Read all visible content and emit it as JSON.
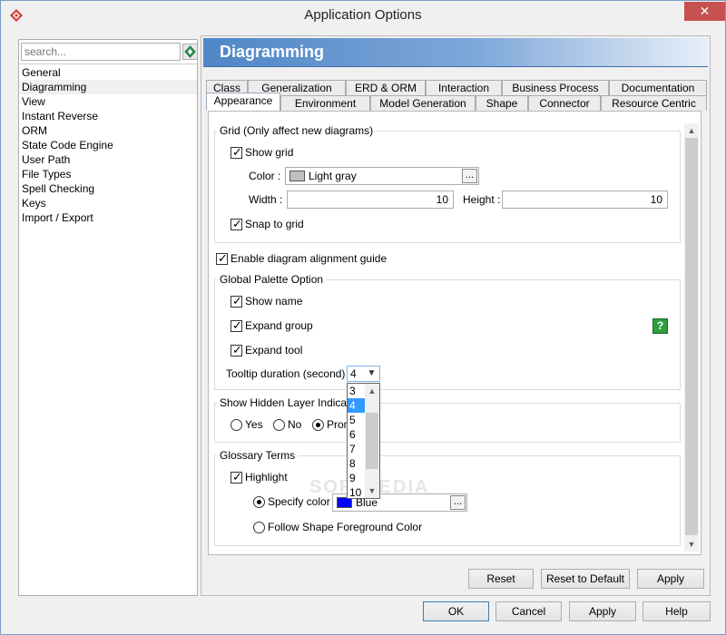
{
  "window": {
    "title": "Application Options",
    "close_glyph": "✕"
  },
  "search": {
    "placeholder": "search...",
    "icon": "diamond-search-icon"
  },
  "sidebar": {
    "items": [
      {
        "label": "General"
      },
      {
        "label": "Diagramming",
        "selected": true
      },
      {
        "label": "View"
      },
      {
        "label": "Instant Reverse"
      },
      {
        "label": "ORM"
      },
      {
        "label": "State Code Engine"
      },
      {
        "label": "User Path"
      },
      {
        "label": "File Types"
      },
      {
        "label": "Spell Checking"
      },
      {
        "label": "Keys"
      },
      {
        "label": "Import / Export"
      }
    ]
  },
  "panel": {
    "title": "Diagramming"
  },
  "tabs": {
    "row1": [
      "Class",
      "Generalization",
      "ERD & ORM",
      "Interaction",
      "Business Process",
      "Documentation"
    ],
    "row2": [
      "Appearance",
      "Environment",
      "Model Generation",
      "Shape",
      "Connector",
      "Resource Centric"
    ],
    "active": "Appearance"
  },
  "grid": {
    "title": "Grid (Only affect new diagrams)",
    "show_grid": {
      "label": "Show grid",
      "checked": true
    },
    "color_label": "Color :",
    "color_value": "Light gray",
    "color_hex": "#c0c0c0",
    "width_label": "Width :",
    "width_value": "10",
    "height_label": "Height :",
    "height_value": "10",
    "snap": {
      "label": "Snap to grid",
      "checked": true
    }
  },
  "alignment": {
    "label": "Enable diagram alignment guide",
    "checked": true
  },
  "palette": {
    "title": "Global Palette Option",
    "show_name": {
      "label": "Show name",
      "checked": true
    },
    "expand_group": {
      "label": "Expand group",
      "checked": true
    },
    "expand_tool": {
      "label": "Expand tool",
      "checked": true
    },
    "tooltip_label": "Tooltip duration (second) :",
    "tooltip_value": "4",
    "help_glyph": "?"
  },
  "dropdown": {
    "options": [
      "3",
      "4",
      "5",
      "6",
      "7",
      "8",
      "9",
      "10"
    ],
    "selected": "4"
  },
  "hidden_layer": {
    "title": "Show Hidden Layer Indicator",
    "yes": "Yes",
    "no": "No",
    "prompt": "Prom",
    "selected": "prompt"
  },
  "glossary": {
    "title": "Glossary Terms",
    "highlight": {
      "label": "Highlight",
      "checked": true
    },
    "specify_color": "Specify color",
    "specify_color_value": "Blue",
    "specify_color_hex": "#0000ff",
    "follow_shape": "Follow Shape Foreground Color",
    "selected": "specify"
  },
  "panel_buttons": {
    "reset": "Reset",
    "reset_default": "Reset to Default",
    "apply": "Apply"
  },
  "dialog_buttons": {
    "ok": "OK",
    "cancel": "Cancel",
    "apply": "Apply",
    "help": "Help"
  },
  "ellipsis": "...",
  "watermark": "SOFTPEDIA"
}
